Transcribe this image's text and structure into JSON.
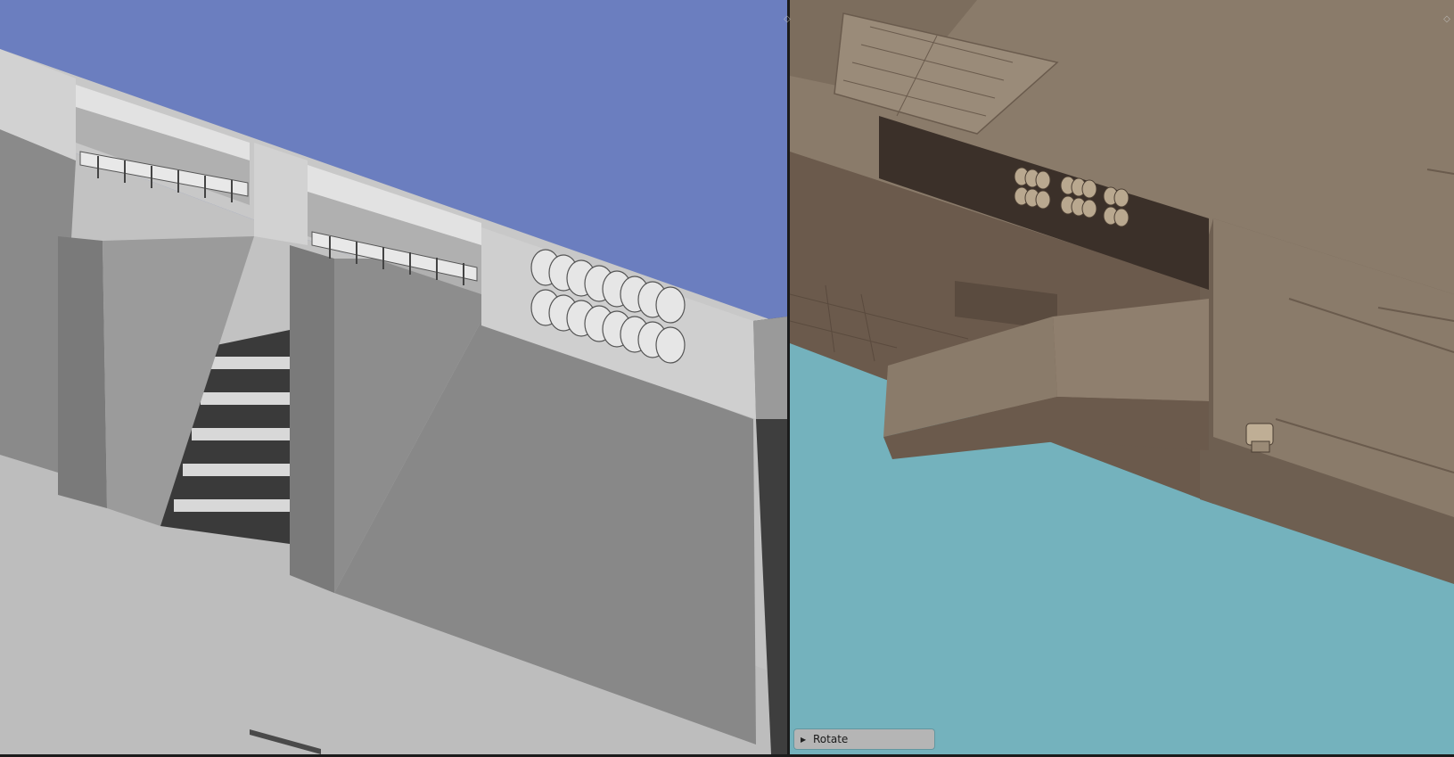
{
  "viewports": {
    "left": {
      "background_color": "#6b7ebf",
      "model_color": "#c4c4c4",
      "shading": "solid"
    },
    "right": {
      "background_color": "#74b2bd",
      "model_color": "#8a7b6a",
      "shading": "textured"
    }
  },
  "operator_panel": {
    "label": "Rotate",
    "icon": "disclosure-triangle-right"
  },
  "corner_handles": {
    "icon": "area-split-icon"
  },
  "colors": {
    "frame": "#1b1b1b",
    "panel_bg": "#b5b5b5"
  }
}
